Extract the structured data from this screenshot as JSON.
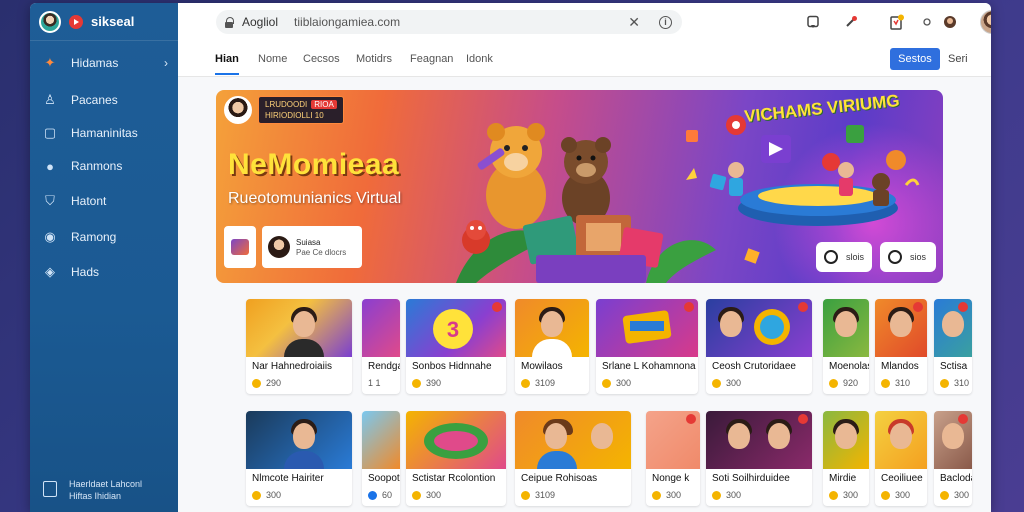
{
  "sidebar": {
    "brand": "sikseal",
    "items": [
      {
        "label": "Hidamas",
        "icon": "puzzle-icon",
        "glyph": "✦",
        "active": true,
        "chevron": "›"
      },
      {
        "label": "Pacanes",
        "icon": "user-icon",
        "glyph": "♙"
      },
      {
        "label": "Hamaninitas",
        "icon": "square-icon",
        "glyph": "▢"
      },
      {
        "label": "Ranmons",
        "icon": "circle-icon",
        "glyph": "●"
      },
      {
        "label": "Hatont",
        "icon": "shield-icon",
        "glyph": "⛉"
      },
      {
        "label": "Ramong",
        "icon": "globe-icon",
        "glyph": "◉"
      },
      {
        "label": "Hads",
        "icon": "drop-icon",
        "glyph": "◈"
      }
    ],
    "footer": "Haerldaet Lahconl\nHiftas Ihidian"
  },
  "topbar": {
    "site_label": "Aogliol",
    "url": "tiiblaiongamiea.com",
    "close_glyph": "✕",
    "info_glyph": "i"
  },
  "tabs": {
    "items": [
      "Hian",
      "Nome",
      "Cecsos",
      "Motidrs",
      "Feagnan",
      "Idonk"
    ],
    "primary_button": "Sestos",
    "secondary_link": "Seri"
  },
  "hero": {
    "badge_line1": "LRUDOODI",
    "badge_line2": "HIRIODIOLLI 10",
    "badge_pill": "RIOA",
    "title": "NeMomieaa",
    "subtitle": "Rueotomunianics Virtual",
    "art_title": "VICHAMS VIRIUMG",
    "card_name": "Suiasa",
    "card_meta": "Pae Ce dlocrs",
    "pill1": "slois",
    "pill2": "sios"
  },
  "row1": [
    {
      "title": "Nar Hahnedroiaiis",
      "views": "290",
      "coin": "gold"
    },
    {
      "title": "Rendga",
      "views": "1 1",
      "coin": "gold"
    },
    {
      "title": "Sonbos Hidnnahe",
      "views": "390",
      "coin": "gold"
    },
    {
      "title": "Mowilaos",
      "views": "3109",
      "coin": "gold"
    },
    {
      "title": "Srlane L Kohamnona",
      "views": "300",
      "coin": "gold"
    },
    {
      "title": "Ceosh Crutoridaee",
      "views": "300",
      "coin": "gold"
    },
    {
      "title": "Moenolas",
      "views": "920",
      "coin": "gold"
    },
    {
      "title": "Mlandos",
      "views": "310",
      "coin": "gold"
    },
    {
      "title": "Sctisa",
      "views": "310",
      "coin": "gold"
    }
  ],
  "row2": [
    {
      "title": "Nlmcote Hairiter",
      "views": "300",
      "coin": "gold"
    },
    {
      "title": "Soopot",
      "views": "60",
      "coin": "blue"
    },
    {
      "title": "Sctistar Rcolontion",
      "views": "300",
      "coin": "gold"
    },
    {
      "title": "Ceipue Rohisoas",
      "views": "3109",
      "coin": "gold"
    },
    {
      "title": "Nonge k",
      "views": "300",
      "coin": "gold"
    },
    {
      "title": "Soti Soilhirduidee",
      "views": "300",
      "coin": "gold"
    },
    {
      "title": "Mirdie",
      "views": "300",
      "coin": "gold"
    },
    {
      "title": "Ceoiliuee",
      "views": "300",
      "coin": "gold"
    },
    {
      "title": "Bacloda",
      "views": "300",
      "coin": "gold"
    }
  ]
}
